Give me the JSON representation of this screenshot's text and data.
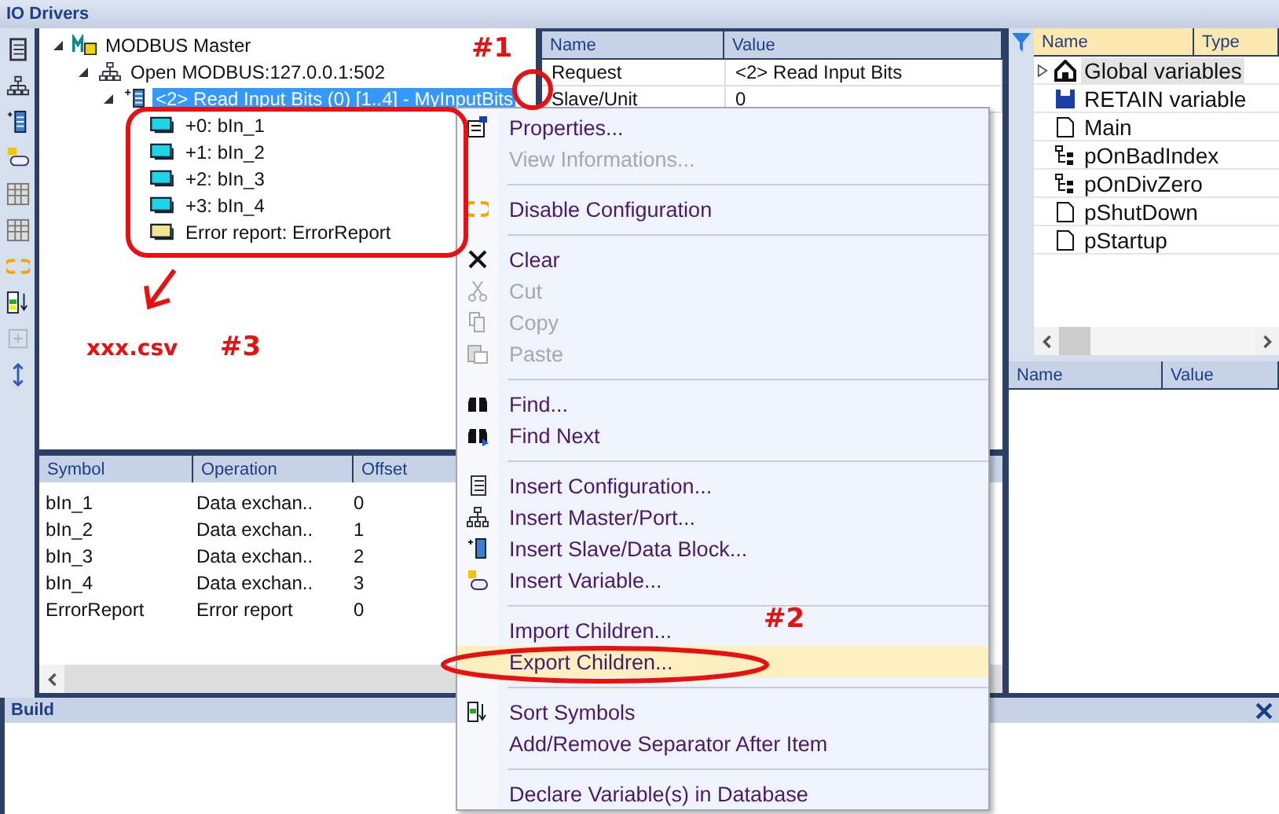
{
  "window": {
    "title": "IO Drivers"
  },
  "tree": [
    {
      "label": "MODBUS Master",
      "kind": "master",
      "expanded": true,
      "selected": false,
      "children": [
        {
          "label": "Open MODBUS:127.0.0.1:502",
          "kind": "port",
          "expanded": true,
          "selected": false,
          "children": [
            {
              "label": "<2> Read Input Bits (0) [1..4] - MyInputBits",
              "kind": "block",
              "expanded": true,
              "selected": true,
              "children": [
                {
                  "label": "+0: bIn_1",
                  "kind": "bit",
                  "selected": false
                },
                {
                  "label": "+1: bIn_2",
                  "kind": "bit",
                  "selected": false
                },
                {
                  "label": "+2: bIn_3",
                  "kind": "bit",
                  "selected": false
                },
                {
                  "label": "+3: bIn_4",
                  "kind": "bit",
                  "selected": false
                },
                {
                  "label": "Error report: ErrorReport",
                  "kind": "error",
                  "selected": false
                }
              ]
            }
          ]
        }
      ]
    }
  ],
  "properties": {
    "columns": [
      "Name",
      "Value"
    ],
    "rows": [
      [
        "Request",
        "<2> Read Input Bits"
      ],
      [
        "Slave/Unit",
        "0"
      ]
    ]
  },
  "symbols": {
    "columns": [
      "Symbol",
      "Operation",
      "Offset"
    ],
    "rows": [
      [
        "bIn_1",
        "Data exchan..",
        "0"
      ],
      [
        "bIn_2",
        "Data exchan..",
        "1"
      ],
      [
        "bIn_3",
        "Data exchan..",
        "2"
      ],
      [
        "bIn_4",
        "Data exchan..",
        "3"
      ],
      [
        "ErrorReport",
        "Error report",
        "0"
      ]
    ]
  },
  "variables": {
    "columns": [
      "Name",
      "Type"
    ],
    "items": [
      {
        "label": "Global variables",
        "kind": "global",
        "expandable": true,
        "selected": true
      },
      {
        "label": "RETAIN variable",
        "kind": "retain",
        "expandable": false,
        "selected": false
      },
      {
        "label": "Main",
        "kind": "program",
        "expandable": false,
        "selected": false
      },
      {
        "label": "pOnBadIndex",
        "kind": "handler",
        "expandable": false,
        "selected": false
      },
      {
        "label": "pOnDivZero",
        "kind": "handler",
        "expandable": false,
        "selected": false
      },
      {
        "label": "pShutDown",
        "kind": "program",
        "expandable": false,
        "selected": false
      },
      {
        "label": "pStartup",
        "kind": "program",
        "expandable": false,
        "selected": false
      }
    ]
  },
  "watch": {
    "columns": [
      "Name",
      "Value"
    ]
  },
  "build": {
    "title": "Build"
  },
  "context_menu": {
    "items": [
      {
        "kind": "item",
        "label": "Properties...",
        "disabled": false,
        "highlighted": false
      },
      {
        "kind": "item",
        "label": "View Informations...",
        "disabled": true,
        "highlighted": false
      },
      {
        "kind": "separator"
      },
      {
        "kind": "item",
        "label": "Disable Configuration",
        "disabled": false,
        "highlighted": false
      },
      {
        "kind": "separator"
      },
      {
        "kind": "item",
        "label": "Clear",
        "disabled": false,
        "highlighted": false
      },
      {
        "kind": "item",
        "label": "Cut",
        "disabled": true,
        "highlighted": false
      },
      {
        "kind": "item",
        "label": "Copy",
        "disabled": true,
        "highlighted": false
      },
      {
        "kind": "item",
        "label": "Paste",
        "disabled": true,
        "highlighted": false
      },
      {
        "kind": "separator"
      },
      {
        "kind": "item",
        "label": "Find...",
        "disabled": false,
        "highlighted": false
      },
      {
        "kind": "item",
        "label": "Find Next",
        "disabled": false,
        "highlighted": false
      },
      {
        "kind": "separator"
      },
      {
        "kind": "item",
        "label": "Insert Configuration...",
        "disabled": false,
        "highlighted": false
      },
      {
        "kind": "item",
        "label": "Insert Master/Port...",
        "disabled": false,
        "highlighted": false
      },
      {
        "kind": "item",
        "label": "Insert Slave/Data Block...",
        "disabled": false,
        "highlighted": false
      },
      {
        "kind": "item",
        "label": "Insert Variable...",
        "disabled": false,
        "highlighted": false
      },
      {
        "kind": "separator"
      },
      {
        "kind": "item",
        "label": "Import Children...",
        "disabled": false,
        "highlighted": false
      },
      {
        "kind": "item",
        "label": "Export Children...",
        "disabled": false,
        "highlighted": true
      },
      {
        "kind": "separator"
      },
      {
        "kind": "item",
        "label": "Sort Symbols",
        "disabled": false,
        "highlighted": false
      },
      {
        "kind": "item",
        "label": "Add/Remove Separator After Item",
        "disabled": false,
        "highlighted": false
      },
      {
        "kind": "separator"
      },
      {
        "kind": "item",
        "label": "Declare Variable(s) in Database",
        "disabled": false,
        "highlighted": false
      }
    ]
  },
  "annotations": [
    "#1",
    "#2",
    "#3",
    "xxx.csv"
  ]
}
